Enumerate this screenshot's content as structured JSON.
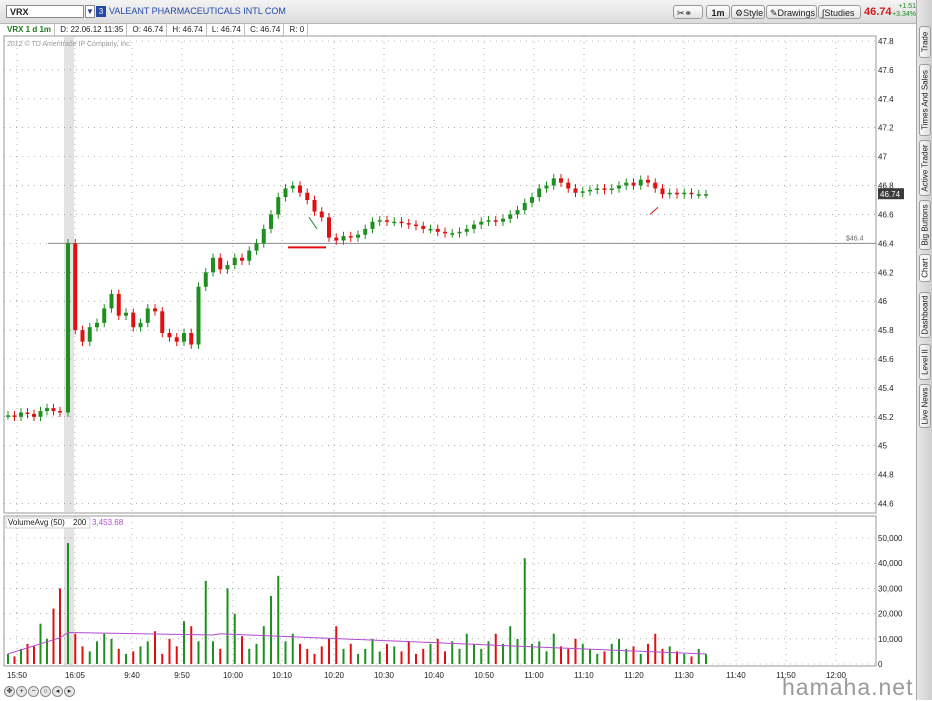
{
  "header": {
    "symbol": "VRX",
    "link_group": "3",
    "company_name": "VALEANT PHARMACEUTICALS INTL COM",
    "interval_button": "1m",
    "style_label": "Style",
    "drawings_label": "Drawings",
    "studies_label": "Studies",
    "last_price": "46.74",
    "change_abs": "+1.51",
    "change_pct": "+3.34%"
  },
  "info_bar": {
    "title": "VRX 1 d 1m",
    "date": "D: 22.06.12 11:35",
    "open": "O: 46.74",
    "high": "H: 46.74",
    "low": "L: 46.74",
    "close": "C: 46.74",
    "range": "R: 0"
  },
  "copyright": "2012 © TD Ameritrade IP Company, Inc.",
  "price_axis": {
    "ticks": [
      "47.8",
      "47.6",
      "47.4",
      "47.2",
      "47",
      "46.8",
      "46.6",
      "46.4",
      "46.2",
      "46",
      "45.8",
      "45.6",
      "45.4",
      "45.2",
      "45",
      "44.8",
      "44.6"
    ],
    "current_price_label": "46.74",
    "price_line_label": "$46.4"
  },
  "volume_panel": {
    "study_name": "VolumeAvg (50)",
    "avg_length": "200",
    "value": "3,453.68",
    "ticks": [
      "50,000",
      "40,000",
      "30,000",
      "20,000",
      "10,000",
      "0"
    ]
  },
  "time_axis": [
    "15:50",
    "16:05",
    "9:40",
    "9:50",
    "10:00",
    "10:10",
    "10:20",
    "10:30",
    "10:40",
    "10:50",
    "11:00",
    "11:10",
    "11:20",
    "11:30",
    "11:40",
    "11:50",
    "12:00"
  ],
  "side_tabs": [
    "Trade",
    "Times And Sales",
    "Active Trader",
    "Big Buttons",
    "Chart",
    "Dashboard",
    "Level II",
    "Live News"
  ],
  "watermark": "hamaha.net",
  "colors": {
    "up": "#1f8f1f",
    "down": "#e01010",
    "volume_avg": "#b44ad0",
    "gridline": "#7a7a7a"
  },
  "chart_data": {
    "type": "candlestick",
    "x_ticks": [
      "15:50",
      "16:05",
      "9:40",
      "9:50",
      "10:00",
      "10:10",
      "10:20",
      "10:30",
      "10:40",
      "10:50",
      "11:00",
      "11:10",
      "11:20",
      "11:30",
      "11:40",
      "11:50",
      "12:00"
    ],
    "ylim": [
      44.5,
      47.8
    ],
    "close": [
      45.21,
      45.2,
      45.23,
      45.22,
      45.2,
      45.24,
      45.26,
      45.24,
      45.23,
      46.4,
      45.8,
      45.72,
      45.82,
      45.85,
      45.95,
      46.05,
      45.9,
      45.92,
      45.82,
      45.85,
      45.95,
      45.93,
      45.78,
      45.75,
      45.72,
      45.78,
      45.7,
      46.1,
      46.2,
      46.3,
      46.22,
      46.25,
      46.3,
      46.28,
      46.35,
      46.4,
      46.5,
      46.6,
      46.72,
      46.78,
      46.8,
      46.75,
      46.7,
      46.62,
      46.58,
      46.44,
      46.42,
      46.45,
      46.44,
      46.46,
      46.5,
      46.55,
      46.56,
      46.55,
      46.55,
      46.54,
      46.53,
      46.52,
      46.5,
      46.5,
      46.48,
      46.47,
      46.47,
      46.48,
      46.5,
      46.53,
      46.55,
      46.56,
      46.55,
      46.57,
      46.6,
      46.63,
      46.68,
      46.72,
      46.78,
      46.8,
      46.85,
      46.82,
      46.78,
      46.75,
      46.76,
      46.77,
      46.78,
      46.77,
      46.78,
      46.8,
      46.82,
      46.8,
      46.84,
      46.82,
      46.78,
      46.74,
      46.75,
      46.74,
      46.75,
      46.74,
      46.74,
      46.74
    ],
    "volume": [
      4,
      3,
      6,
      8,
      7,
      16,
      10,
      22,
      30,
      48,
      12,
      7,
      5,
      9,
      12,
      10,
      6,
      4,
      5,
      7,
      9,
      13,
      4,
      10,
      7,
      17,
      15,
      9,
      33,
      9,
      6,
      30,
      20,
      11,
      6,
      8,
      15,
      27,
      35,
      9,
      12,
      8,
      6,
      4,
      7,
      10,
      15,
      6,
      8,
      4,
      6,
      10,
      5,
      8,
      7,
      5,
      9,
      4,
      6,
      8,
      10,
      5,
      9,
      6,
      12,
      8,
      6,
      9,
      12,
      8,
      15,
      10,
      42,
      8,
      9,
      5,
      12,
      7,
      6,
      10,
      8,
      6,
      4,
      5,
      8,
      10,
      6,
      7,
      4,
      8,
      12,
      6,
      7,
      5,
      4,
      3,
      6,
      4
    ]
  }
}
